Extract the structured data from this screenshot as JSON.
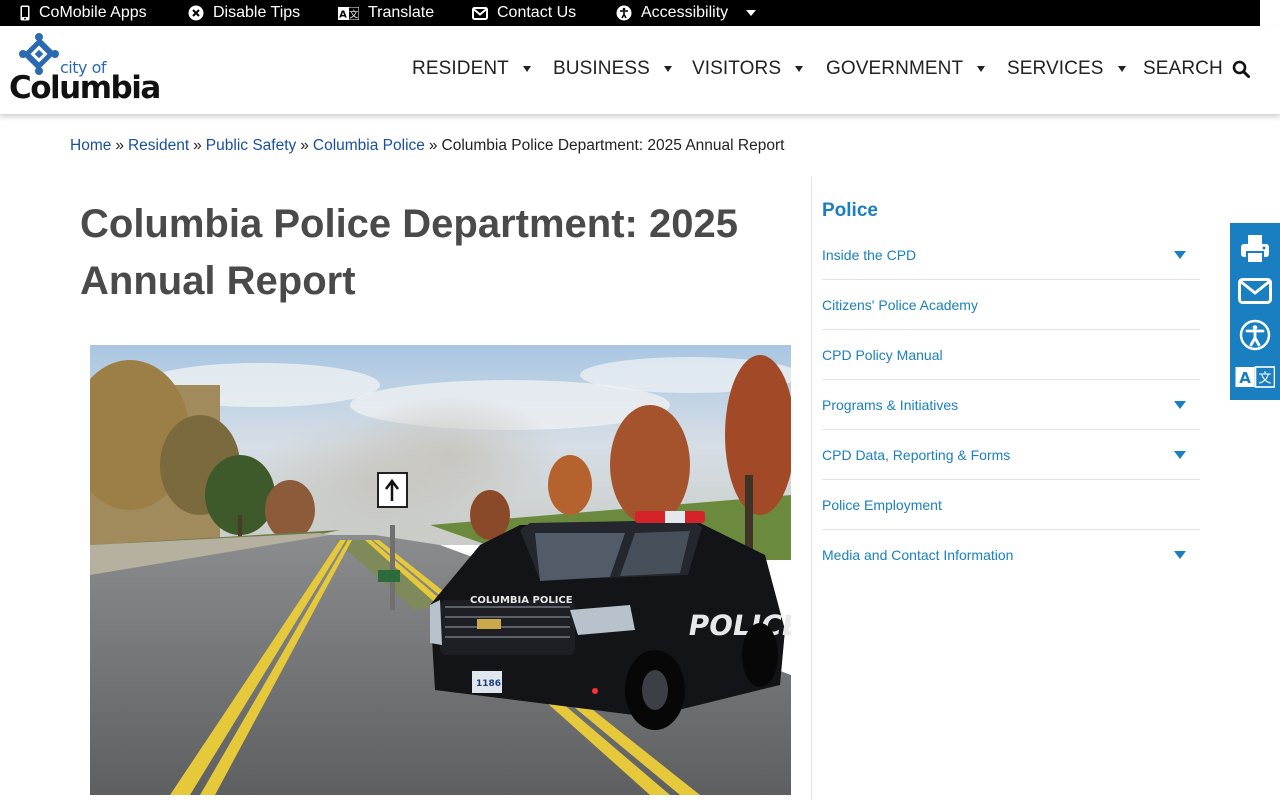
{
  "utility_bar": {
    "mobile_apps": "CoMobile Apps",
    "disable_tips": "Disable Tips",
    "translate": "Translate",
    "contact_us": "Contact Us",
    "accessibility": "Accessibility"
  },
  "logo": {
    "city_of": "city of",
    "name": "Columbia"
  },
  "nav": {
    "items": [
      {
        "label": "RESIDENT"
      },
      {
        "label": "BUSINESS"
      },
      {
        "label": "VISITORS"
      },
      {
        "label": "GOVERNMENT"
      },
      {
        "label": "SERVICES"
      }
    ],
    "search_label": "SEARCH"
  },
  "breadcrumb": {
    "items": [
      {
        "label": "Home"
      },
      {
        "label": "Resident"
      },
      {
        "label": "Public Safety"
      },
      {
        "label": "Columbia Police"
      }
    ],
    "separator": "»",
    "current": "Columbia Police Department: 2025 Annual Report"
  },
  "page": {
    "title": "Columbia Police Department: 2025 Annual Report"
  },
  "hero_image": {
    "badge_text": "COLUMBIA POLICE",
    "door_text": "POLICE",
    "plate": "1186"
  },
  "sidebar": {
    "title": "Police",
    "items": [
      {
        "label": "Inside the CPD",
        "expandable": true
      },
      {
        "label": "Citizens' Police Academy",
        "expandable": false
      },
      {
        "label": "CPD Policy Manual",
        "expandable": false
      },
      {
        "label": "Programs & Initiatives",
        "expandable": true
      },
      {
        "label": "CPD Data, Reporting & Forms",
        "expandable": true
      },
      {
        "label": "Police Employment",
        "expandable": false
      },
      {
        "label": "Media and Contact Information",
        "expandable": true
      }
    ]
  },
  "share_toolbar": {
    "icons": [
      "print-icon",
      "email-icon",
      "accessibility-icon",
      "translate-icon"
    ]
  },
  "colors": {
    "brand_blue": "#1a7fc1",
    "link_blue": "#1a4fa0",
    "title_gray": "#4a4a4a",
    "utility_bar_bg": "#000000"
  }
}
